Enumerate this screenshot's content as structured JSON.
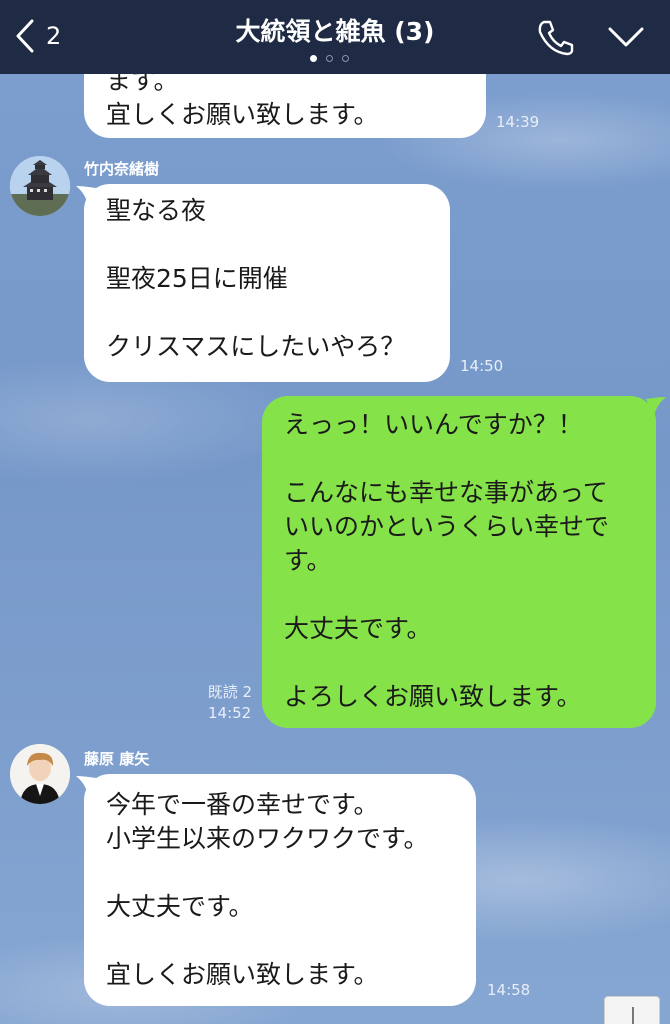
{
  "header": {
    "back_count": "2",
    "title": "大統領と雑魚 (3)",
    "page_dots": 3,
    "active_dot": 0,
    "background_color": "#1f2a44"
  },
  "messages": [
    {
      "type": "received",
      "text": "ます。\n宜しくお願い致します。",
      "time": "14:39"
    },
    {
      "type": "received",
      "sender": "竹内奈緒樹",
      "avatar_icon": "castle-avatar-icon",
      "text": "聖なる夜\n\n聖夜25日に開催\n\nクリスマスにしたいやろ？",
      "time": "14:50"
    },
    {
      "type": "sent",
      "text": "えっっ！いいんですか？！\n\nこんなにも幸せな事があって\nいいのかというくらい幸せで\nす。\n\n大丈夫です。\n\nよろしくお願い致します。",
      "read": "既読 2",
      "time": "14:52"
    },
    {
      "type": "received",
      "sender": "藤原 康矢",
      "avatar_icon": "person-avatar-icon",
      "text": "今年で一番の幸せです。\n小学生以来のワクワクです。\n\n大丈夫です。\n\n宜しくお願い致します。",
      "time": "14:58"
    }
  ],
  "colors": {
    "sent_bubble": "#85e249",
    "received_bubble": "#ffffff",
    "chat_background": "#7b9ccb"
  }
}
